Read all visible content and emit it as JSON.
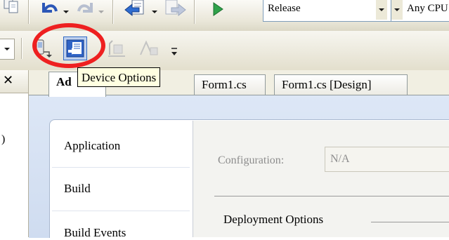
{
  "toolbar_top": {
    "icons": [
      "copy-icon",
      "undo-icon",
      "redo-icon",
      "navigate-backward-icon",
      "navigate-forward-icon",
      "start-debugging-icon"
    ],
    "configuration_value": "Release",
    "platform_value": "Any CPU"
  },
  "toolbar_device": {
    "icons": [
      "connect-to-device-icon",
      "device-options-icon",
      "format-align-icon",
      "format-size-icon",
      "toolbar-overflow-icon"
    ],
    "tooltip": "Device Options"
  },
  "annotation_color": "#ee2020",
  "left_panel": {
    "close_glyph": "✕",
    "partial_text": ")"
  },
  "tabs": [
    {
      "label": "Ad"
    },
    {
      "label": "Form1.cs"
    },
    {
      "label": "Form1.cs [Design]"
    }
  ],
  "properties": {
    "nav": [
      {
        "label": "Application"
      },
      {
        "label": "Build"
      },
      {
        "label": "Build Events"
      }
    ],
    "configuration_label": "Configuration:",
    "configuration_value": "N/A",
    "section_header": "Deployment Options"
  }
}
